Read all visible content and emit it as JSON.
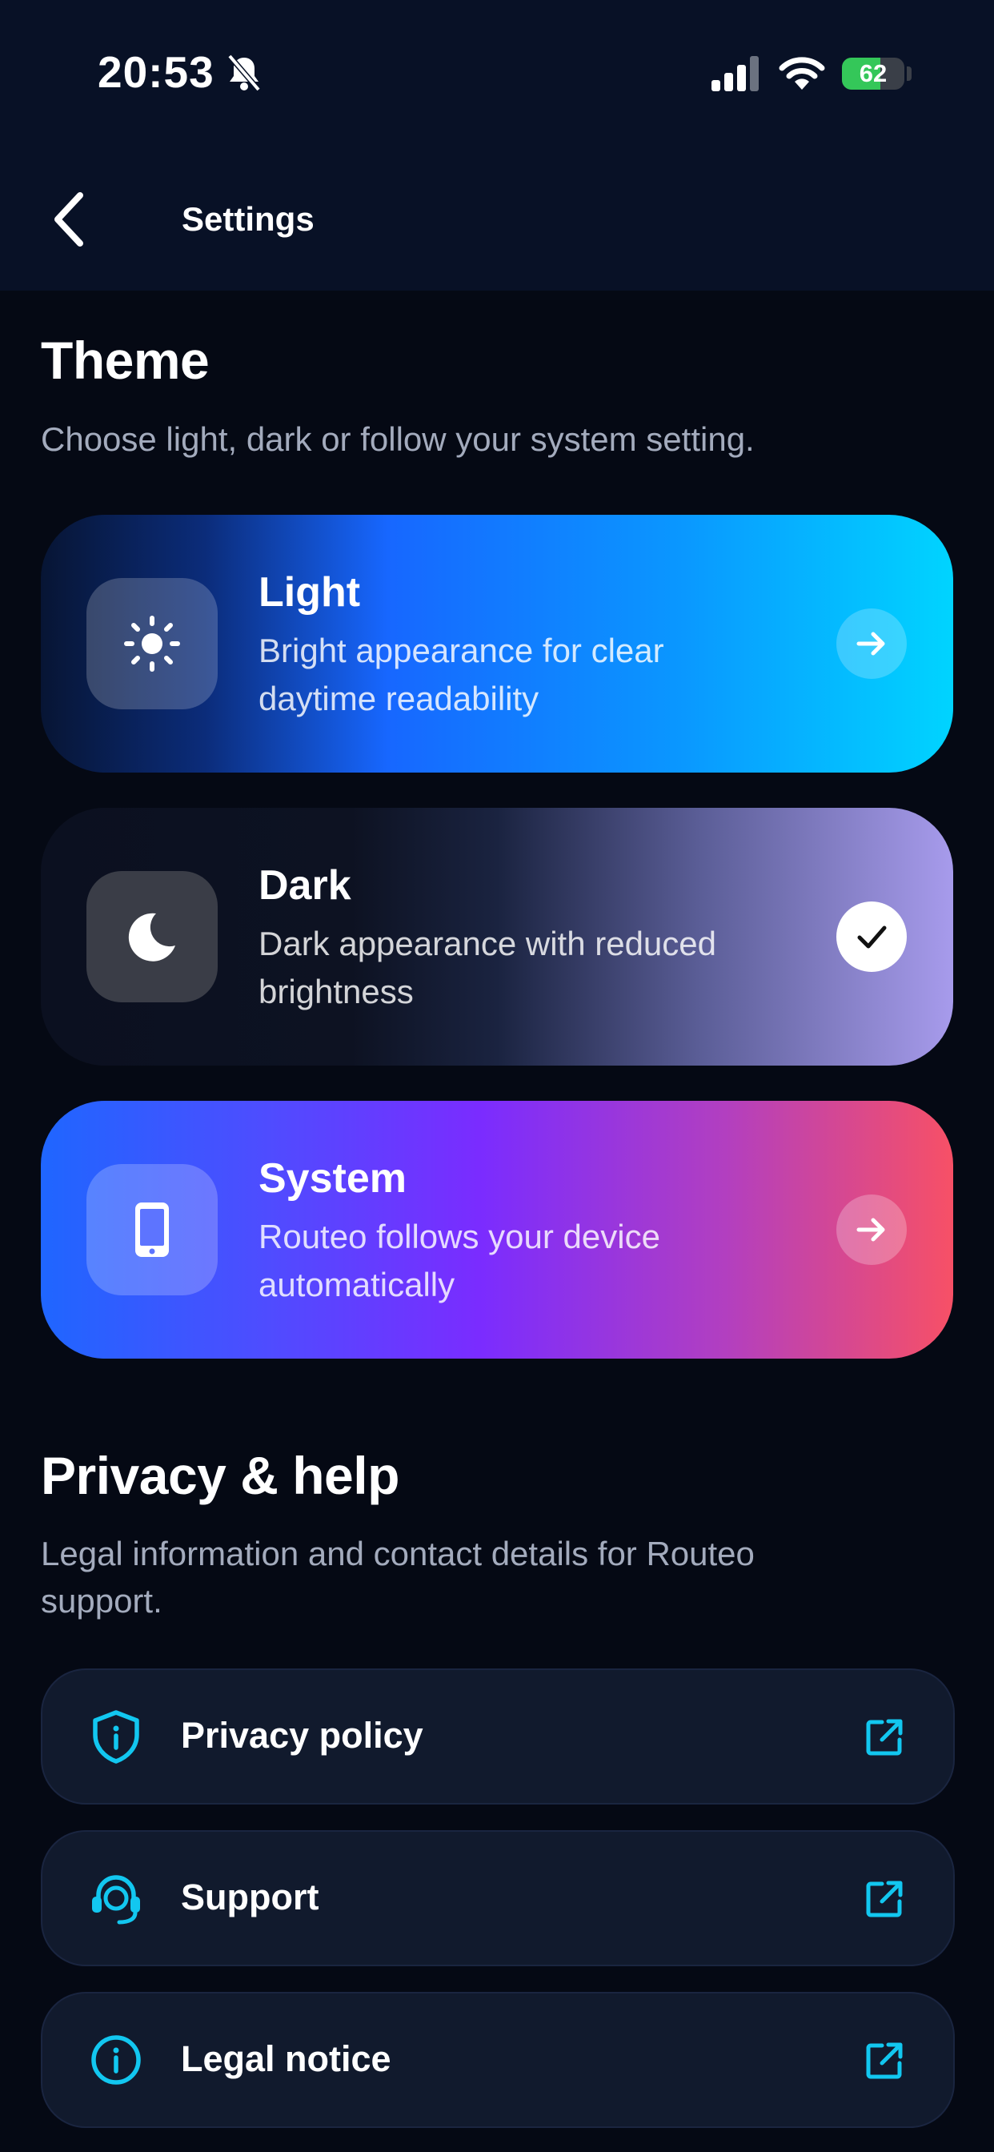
{
  "status_bar": {
    "time": "20:53",
    "battery": "62"
  },
  "nav": {
    "title": "Settings"
  },
  "theme_section": {
    "title": "Theme",
    "description": "Choose light, dark or follow your system setting.",
    "options": [
      {
        "title": "Light",
        "description": "Bright appearance for clear daytime readability",
        "icon": "sun-icon",
        "selected": false
      },
      {
        "title": "Dark",
        "description": "Dark appearance with reduced brightness",
        "icon": "moon-icon",
        "selected": true
      },
      {
        "title": "System",
        "description": "Routeo follows your device automatically",
        "icon": "phone-icon",
        "selected": false
      }
    ]
  },
  "privacy_section": {
    "title": "Privacy & help",
    "description": "Legal information and contact details for Routeo support.",
    "links": [
      {
        "label": "Privacy policy",
        "icon": "shield-icon"
      },
      {
        "label": "Support",
        "icon": "headset-icon"
      },
      {
        "label": "Legal notice",
        "icon": "info-icon"
      }
    ]
  },
  "colors": {
    "header_bg": "#081126",
    "page_bg": "#050914",
    "accent_cyan": "#12c7f0",
    "battery_green": "#34c759"
  }
}
